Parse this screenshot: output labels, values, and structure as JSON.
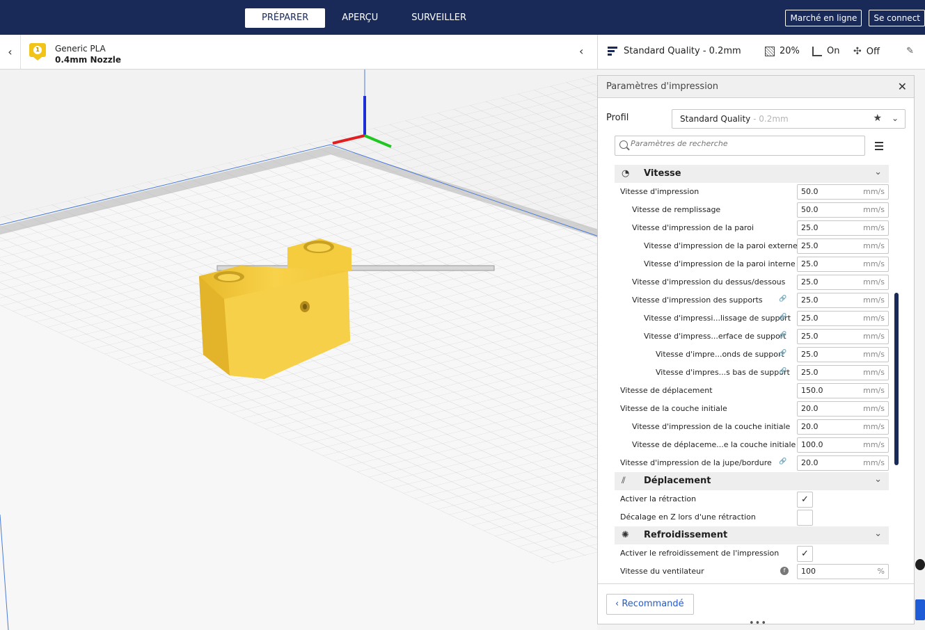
{
  "topbar": {
    "tabs": [
      {
        "label": "PRÉPARER",
        "active": true
      },
      {
        "label": "APERÇU",
        "active": false
      },
      {
        "label": "SURVEILLER",
        "active": false
      }
    ],
    "marketplace_label": "Marché en ligne",
    "signin_label": "Se connect"
  },
  "printer": {
    "extruder_number": "1",
    "material": "Generic PLA",
    "nozzle": "0.4mm Nozzle"
  },
  "quality": {
    "profile_name": "Standard Quality - 0.2mm",
    "infill": "20%",
    "support": "On",
    "adhesion": "Off"
  },
  "panel": {
    "title": "Paramètres d'impression",
    "profile_label": "Profil",
    "profile_value": "Standard Quality",
    "profile_sub": " - 0.2mm",
    "search_placeholder": "Paramètres de recherche",
    "recommended_label": "Recommandé"
  },
  "categories": {
    "speed": {
      "title": "Vitesse",
      "icon": "speedometer-icon",
      "rows": [
        {
          "label": "Vitesse d'impression",
          "value": "50.0",
          "unit": "mm/s",
          "indent": 0,
          "linked": false
        },
        {
          "label": "Vitesse de remplissage",
          "value": "50.0",
          "unit": "mm/s",
          "indent": 1,
          "linked": false
        },
        {
          "label": "Vitesse d'impression de la paroi",
          "value": "25.0",
          "unit": "mm/s",
          "indent": 1,
          "linked": false
        },
        {
          "label": "Vitesse d'impression de la paroi externe",
          "value": "25.0",
          "unit": "mm/s",
          "indent": 2,
          "linked": false
        },
        {
          "label": "Vitesse d'impression de la paroi interne",
          "value": "25.0",
          "unit": "mm/s",
          "indent": 2,
          "linked": false
        },
        {
          "label": "Vitesse d'impression du dessus/dessous",
          "value": "25.0",
          "unit": "mm/s",
          "indent": 1,
          "linked": false
        },
        {
          "label": "Vitesse d'impression des supports",
          "value": "25.0",
          "unit": "mm/s",
          "indent": 1,
          "linked": true
        },
        {
          "label": "Vitesse d'impressi...lissage de support",
          "value": "25.0",
          "unit": "mm/s",
          "indent": 2,
          "linked": true
        },
        {
          "label": "Vitesse d'impress...erface de support",
          "value": "25.0",
          "unit": "mm/s",
          "indent": 2,
          "linked": true
        },
        {
          "label": "Vitesse d'impre...onds de support",
          "value": "25.0",
          "unit": "mm/s",
          "indent": 3,
          "linked": true
        },
        {
          "label": "Vitesse d'impres...s bas de support",
          "value": "25.0",
          "unit": "mm/s",
          "indent": 3,
          "linked": true
        },
        {
          "label": "Vitesse de déplacement",
          "value": "150.0",
          "unit": "mm/s",
          "indent": 0,
          "linked": false
        },
        {
          "label": "Vitesse de la couche initiale",
          "value": "20.0",
          "unit": "mm/s",
          "indent": 0,
          "linked": false
        },
        {
          "label": "Vitesse d'impression de la couche initiale",
          "value": "20.0",
          "unit": "mm/s",
          "indent": 1,
          "linked": false
        },
        {
          "label": "Vitesse de déplaceme...e la couche initiale",
          "value": "100.0",
          "unit": "mm/s",
          "indent": 1,
          "linked": false
        },
        {
          "label": "Vitesse d'impression de la jupe/bordure",
          "value": "20.0",
          "unit": "mm/s",
          "indent": 0,
          "linked": true
        }
      ]
    },
    "travel": {
      "title": "Déplacement",
      "icon": "travel-icon",
      "rows": [
        {
          "label": "Activer la rétraction",
          "checked": true
        },
        {
          "label": "Décalage en Z lors d'une rétraction",
          "checked": false
        }
      ]
    },
    "cooling": {
      "title": "Refroidissement",
      "icon": "fan-icon",
      "rows": [
        {
          "label": "Activer le refroidissement de l'impression",
          "checked": true
        },
        {
          "label": "Vitesse du ventilateur",
          "value": "100",
          "unit": "%",
          "info": true
        }
      ]
    }
  },
  "colors": {
    "topbar": "#192a58",
    "accent": "#1e5bd6",
    "model": "#f5cf3c",
    "grid": "#c8c8c8"
  }
}
